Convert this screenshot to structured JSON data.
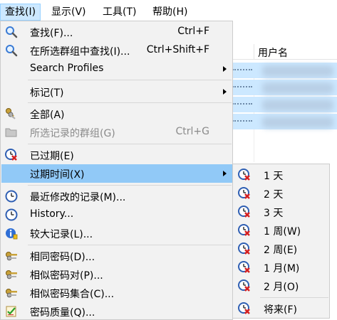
{
  "menubar": {
    "items": [
      {
        "label": "查找(I)"
      },
      {
        "label": "显示(V)"
      },
      {
        "label": "工具(T)"
      },
      {
        "label": "帮助(H)"
      }
    ]
  },
  "background": {
    "column_header": "用户名"
  },
  "find_menu": {
    "items": [
      {
        "label": "查找(F)...",
        "shortcut": "Ctrl+F",
        "icon": "magnifier-icon"
      },
      {
        "label": "在所选群组中查找(I)...",
        "shortcut": "Ctrl+Shift+F",
        "icon": "magnifier-icon"
      },
      {
        "label": "Search Profiles"
      },
      {
        "label": "标记(T)"
      },
      {
        "label": "全部(A)",
        "icon": "keys-icon"
      },
      {
        "label": "所选记录的群组(G)",
        "shortcut": "Ctrl+G",
        "icon": "folder-icon"
      },
      {
        "label": "已过期(E)",
        "icon": "expired-clock-icon"
      },
      {
        "label": "过期时间(X)"
      },
      {
        "label": "最近修改的记录(M)...",
        "icon": "clock-icon"
      },
      {
        "label": "History...",
        "icon": "clock-icon"
      },
      {
        "label": "较大记录(L)...",
        "icon": "info-icon"
      },
      {
        "label": "相同密码(D)...",
        "icon": "keys-icon"
      },
      {
        "label": "相似密码对(P)...",
        "icon": "keys-icon"
      },
      {
        "label": "相似密码集合(C)...",
        "icon": "keys-icon"
      },
      {
        "label": "密码质量(Q)...",
        "icon": "quality-icon"
      }
    ]
  },
  "expiry_submenu": {
    "items": [
      {
        "label": "1 天"
      },
      {
        "label": "2 天"
      },
      {
        "label": "3 天"
      },
      {
        "label": "1 周(W)"
      },
      {
        "label": "2 周(E)"
      },
      {
        "label": "1 月(M)"
      },
      {
        "label": "2 月(O)"
      },
      {
        "label": "将来(F)"
      }
    ]
  },
  "colors": {
    "menu_bg": "#f2f2f2",
    "highlight": "#91c9f7",
    "active_menubar": "#cce8ff",
    "disabled_text": "#8a8a8a"
  }
}
